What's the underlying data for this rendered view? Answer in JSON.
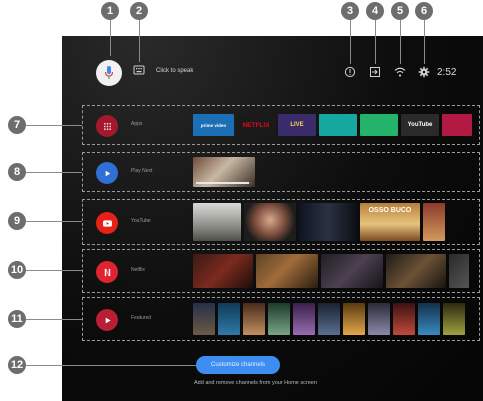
{
  "top_bar": {
    "assistant_hint": "Click to speak",
    "clock": "2:52"
  },
  "callouts": [
    "1",
    "2",
    "3",
    "4",
    "5",
    "6",
    "7",
    "8",
    "9",
    "10",
    "11",
    "12"
  ],
  "rows": [
    {
      "label": "Apps",
      "apps": [
        {
          "name": "prime video",
          "bg": "#1b6fb5",
          "fg": "#ffffff"
        },
        {
          "name": "NETFLIX",
          "bg": "#1a1a1a",
          "fg": "#e50914"
        },
        {
          "name": "LIVE",
          "bg": "#3a2b6b",
          "fg": "#ffd84a"
        },
        {
          "name": "",
          "bg": "#16a8a0",
          "fg": "#ffffff"
        },
        {
          "name": "",
          "bg": "#23b36a",
          "fg": "#ffffff"
        },
        {
          "name": "YouTube",
          "bg": "#2a2a2a",
          "fg": "#ffffff"
        },
        {
          "name": "",
          "bg": "#b21a44",
          "fg": "#ffffff"
        }
      ]
    },
    {
      "label": "Play Next"
    },
    {
      "label": "YouTube",
      "thumb_texts": [
        "",
        "",
        "",
        "OSSO BUCO",
        ""
      ]
    },
    {
      "label": "Netflix"
    },
    {
      "label": "Featured"
    }
  ],
  "customize": {
    "button": "Customize channels",
    "subtitle": "Add and remove channels from your Home screen"
  },
  "colors": {
    "accent": "#3d8ef0",
    "apps_icon": "#a3182d",
    "playnext_icon": "#2f6fd6",
    "youtube_icon": "#e62117",
    "netflix_icon": "#e0242f",
    "featured_icon": "#b81e34"
  }
}
